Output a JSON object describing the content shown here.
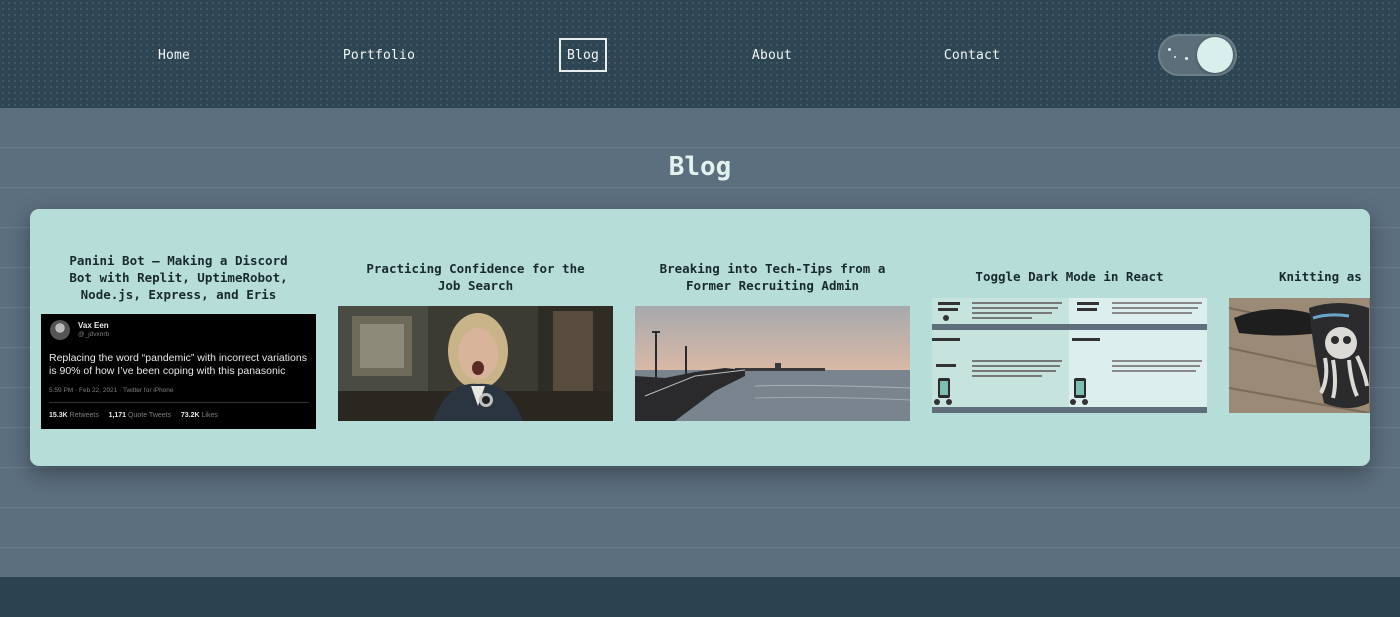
{
  "nav": {
    "links": [
      "Home",
      "Portfolio",
      "Blog",
      "About",
      "Contact"
    ],
    "active": "Blog",
    "theme_toggle": "dark-mode-toggle"
  },
  "page": {
    "title": "Blog"
  },
  "posts": [
    {
      "title": "Panini Bot — Making a Discord Bot with Replit, UptimeRobot, Node.js, Express, and Eris",
      "tweet": {
        "name": "Vax Een",
        "handle": "@_jdvxnrb",
        "text_line1": "Replacing the word “pandemic” with incorrect variations",
        "text_line2": "is 90% of how I’ve been coping with this panasonic",
        "meta": "5:59 PM · Feb 22, 2021 · Twitter for iPhone",
        "retweets": "15.3K",
        "retweets_label": "Retweets",
        "quotes": "1,171",
        "quotes_label": "Quote Tweets",
        "likes": "73.2K",
        "likes_label": "Likes"
      }
    },
    {
      "title": "Practicing Confidence for the Job Search"
    },
    {
      "title": "Breaking into Tech-Tips from a Former Recruiting Admin"
    },
    {
      "title": "Toggle Dark Mode in React"
    },
    {
      "title": "Knitting as"
    }
  ],
  "colors": {
    "nav_bg": "#2e4653",
    "main_bg": "#5c6f7f",
    "card_bg": "#b7ddd8",
    "title_color": "#e3f1ef",
    "post_title_color": "#182a2e"
  }
}
